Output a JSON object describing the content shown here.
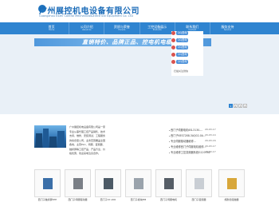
{
  "header": {
    "title": "广州展控机电设备有限公司",
    "subtitle": "Guangzhou Exzhi Control Mechanical&Electrical Equipment Co. LTD"
  },
  "nav": [
    {
      "zh": "首页",
      "en": "Home"
    },
    {
      "zh": "公司介绍",
      "en": "About Us"
    },
    {
      "zh": "资质与荣誉",
      "en": "Honors"
    },
    {
      "zh": "工控设备展示",
      "en": "Products"
    },
    {
      "zh": "联系我们",
      "en": "Contact"
    },
    {
      "zh": "服务支持",
      "en": "Service"
    }
  ],
  "banner": {
    "text": "直销特价、品牌正品、控电机电缆"
  },
  "qq": {
    "buttons": [
      "QQ咨询",
      "QQ咨询",
      "QQ咨询",
      "QQ咨询",
      "QQ咨询"
    ],
    "title": "扫描关注微信"
  },
  "pager": [
    "1",
    "2",
    "3",
    "4"
  ],
  "about": {
    "paragraph": "广州展控机电设备有限公司是一家专业从事代理工控产品销售、技术支持、维修、安装调试、工程服务的综合型公司，业务范围覆盖全国各地，主营PLC、伺服、变频器、触摸屏等工控产品，产品齐全，价格优惠，欢迎来电洽谈合作。"
  },
  "news": [
    {
      "title": "西门子伺服电机6SL3130-...",
      "date": "20-03-17"
    },
    {
      "title": "西门子6ES7288-3AQ02-0A...",
      "date": "20-03-14"
    },
    {
      "title": "专业伺服驱动器维修...",
      "date": "20-03-16"
    },
    {
      "title": "专业维修西门子伺服电机维修...",
      "date": "20-03-17"
    },
    {
      "title": "专业维修工控变频器系统G120-RI2",
      "date": "20-03-17"
    }
  ],
  "products": [
    {
      "caption": "西门子触摸屏KTP"
    },
    {
      "caption": "西门子伺服驱动器"
    },
    {
      "caption": "西门子S7-200"
    },
    {
      "caption": "西门子模块EM"
    },
    {
      "caption": "西门子伺服电机"
    },
    {
      "caption": "西门子变频器"
    },
    {
      "caption": "施耐德接触器"
    },
    {
      "caption": "西门子PLC"
    }
  ],
  "colors": {
    "brand": "#1a6bb8",
    "nav": "#2f84d0",
    "banner_bg": "#e9f0f7"
  }
}
